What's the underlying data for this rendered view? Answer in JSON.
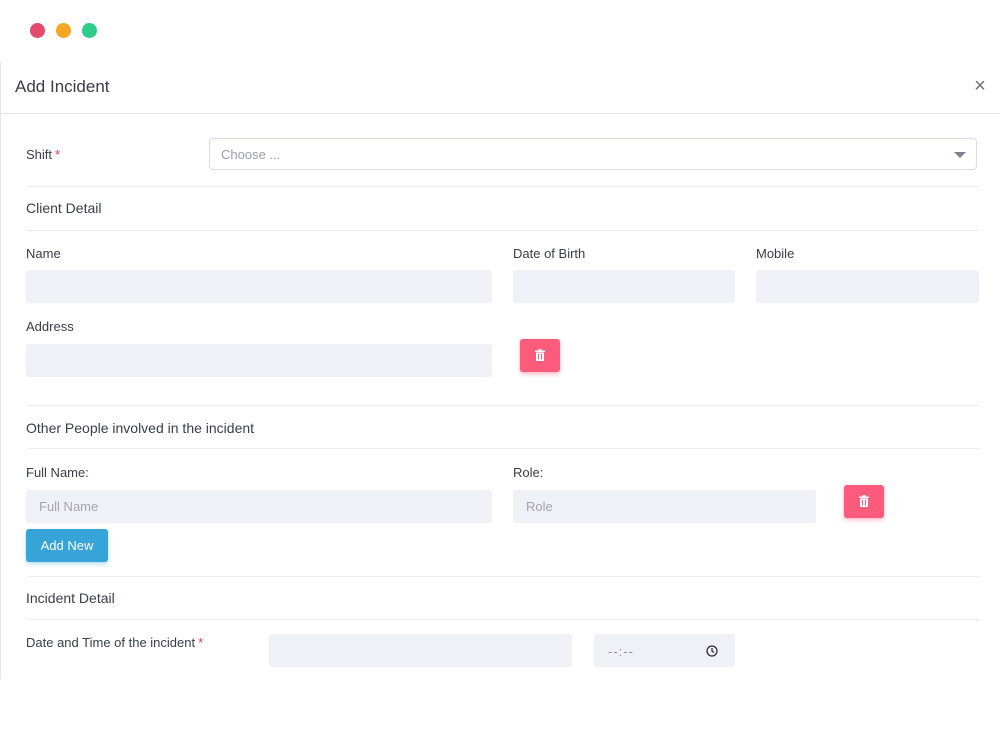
{
  "window": {
    "controls": [
      "close",
      "minimize",
      "maximize"
    ]
  },
  "modal": {
    "title": "Add Incident",
    "close_icon": "×"
  },
  "shift": {
    "label": "Shift",
    "required_mark": "*",
    "placeholder": "Choose ..."
  },
  "client_detail": {
    "title": "Client Detail",
    "name_label": "Name",
    "dob_label": "Date of Birth",
    "mobile_label": "Mobile",
    "address_label": "Address"
  },
  "other_people": {
    "title": "Other People involved in the incident",
    "full_name_label": "Full Name:",
    "full_name_placeholder": "Full Name",
    "role_label": "Role:",
    "role_placeholder": "Role",
    "add_new_label": "Add New"
  },
  "incident_detail": {
    "title": "Incident Detail",
    "datetime_label": "Date and Time of the incident",
    "required_mark": "*",
    "time_placeholder": "--:--"
  },
  "colors": {
    "danger": "#fc5b7c",
    "primary": "#36a3d9",
    "input_bg": "#f0f1f6",
    "required": "#e6385a"
  },
  "icons": [
    "trash-icon",
    "clock-icon",
    "chevron-down-icon",
    "close-icon"
  ]
}
